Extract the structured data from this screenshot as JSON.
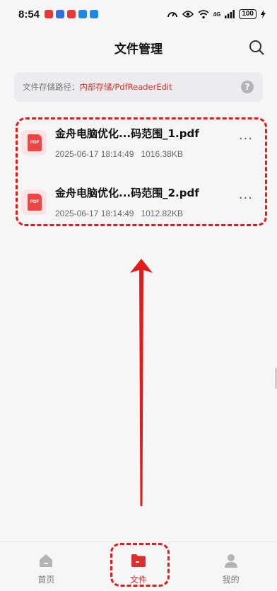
{
  "status_bar": {
    "time": "8:54",
    "notifications": [
      {
        "icon": "app-notification-icon",
        "color": "#e53935"
      },
      {
        "icon": "app-notification-icon",
        "color": "#2f6fde"
      },
      {
        "icon": "app-notification-icon",
        "color": "#e53935"
      },
      {
        "icon": "app-notification-icon",
        "color": "#1e88e5"
      },
      {
        "icon": "app-notification-icon",
        "color": "#1e88e5"
      }
    ],
    "network": "4G",
    "battery": "100"
  },
  "header": {
    "title": "文件管理",
    "search_icon": "search-icon"
  },
  "path": {
    "label": "文件存储路径：",
    "value": "内部存储/PdfReaderEdit",
    "help_icon": "?"
  },
  "files": [
    {
      "name": "金舟电脑优化...码范围_1.pdf",
      "date": "2025-06-17 18:14:49",
      "size": "1016.38KB",
      "icon_text": "PDF",
      "more": "···"
    },
    {
      "name": "金舟电脑优化...码范围_2.pdf",
      "date": "2025-06-17 18:14:49",
      "size": "1012.82KB",
      "icon_text": "PDF",
      "more": "···"
    }
  ],
  "bottom_nav": {
    "items": [
      {
        "label": "首页",
        "icon": "home-icon",
        "active": false
      },
      {
        "label": "文件",
        "icon": "folder-icon",
        "active": true
      },
      {
        "label": "我的",
        "icon": "profile-icon",
        "active": false
      }
    ]
  },
  "colors": {
    "accent": "#d9302c",
    "annotation": "#e21b1b"
  }
}
